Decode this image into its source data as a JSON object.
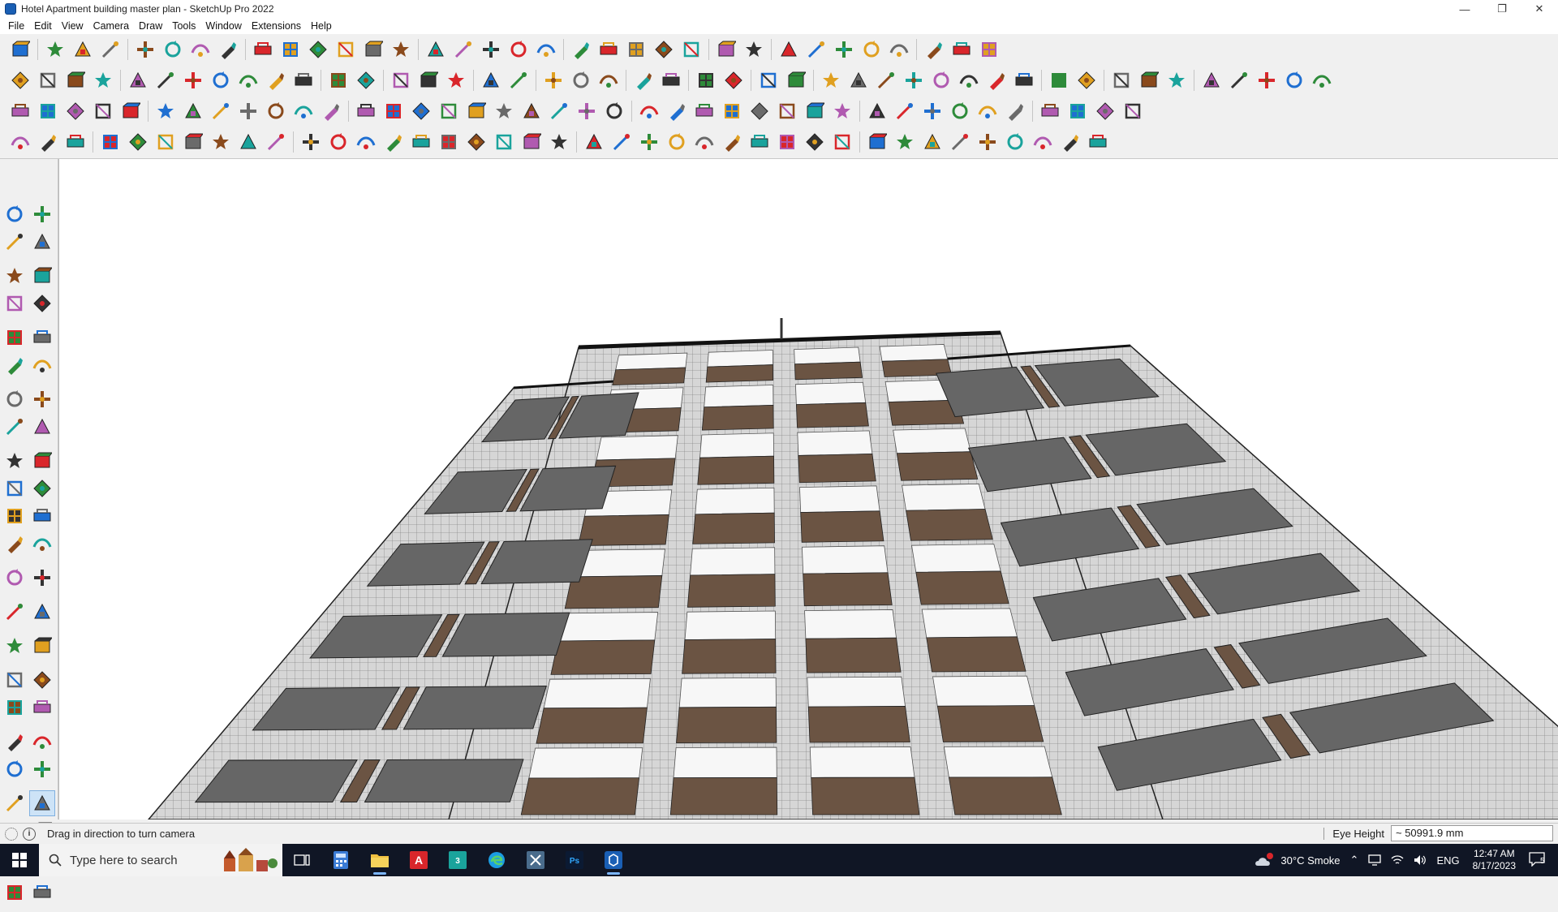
{
  "window": {
    "title": "Hotel Apartment building master plan - SketchUp Pro 2022",
    "minimize": "—",
    "maximize": "❐",
    "close": "✕"
  },
  "menu": [
    "File",
    "Edit",
    "View",
    "Camera",
    "Draw",
    "Tools",
    "Window",
    "Extensions",
    "Help"
  ],
  "status": {
    "hint": "Drag in direction to turn camera",
    "vcb_label": "Eye Height",
    "vcb_value": "~ 50991.9 mm"
  },
  "taskbar": {
    "search_placeholder": "Type here to search",
    "weather": "30°C  Smoke",
    "language": "ENG",
    "time": "12:47 AM",
    "date": "8/17/2023",
    "notifications": "5"
  },
  "colors": {
    "accent": "#d9262b",
    "toolbar_blue": "#1f6fd1",
    "building_frame": "#cfcfcf",
    "building_brown": "#6b5443",
    "glass": "#5a5a5a"
  }
}
